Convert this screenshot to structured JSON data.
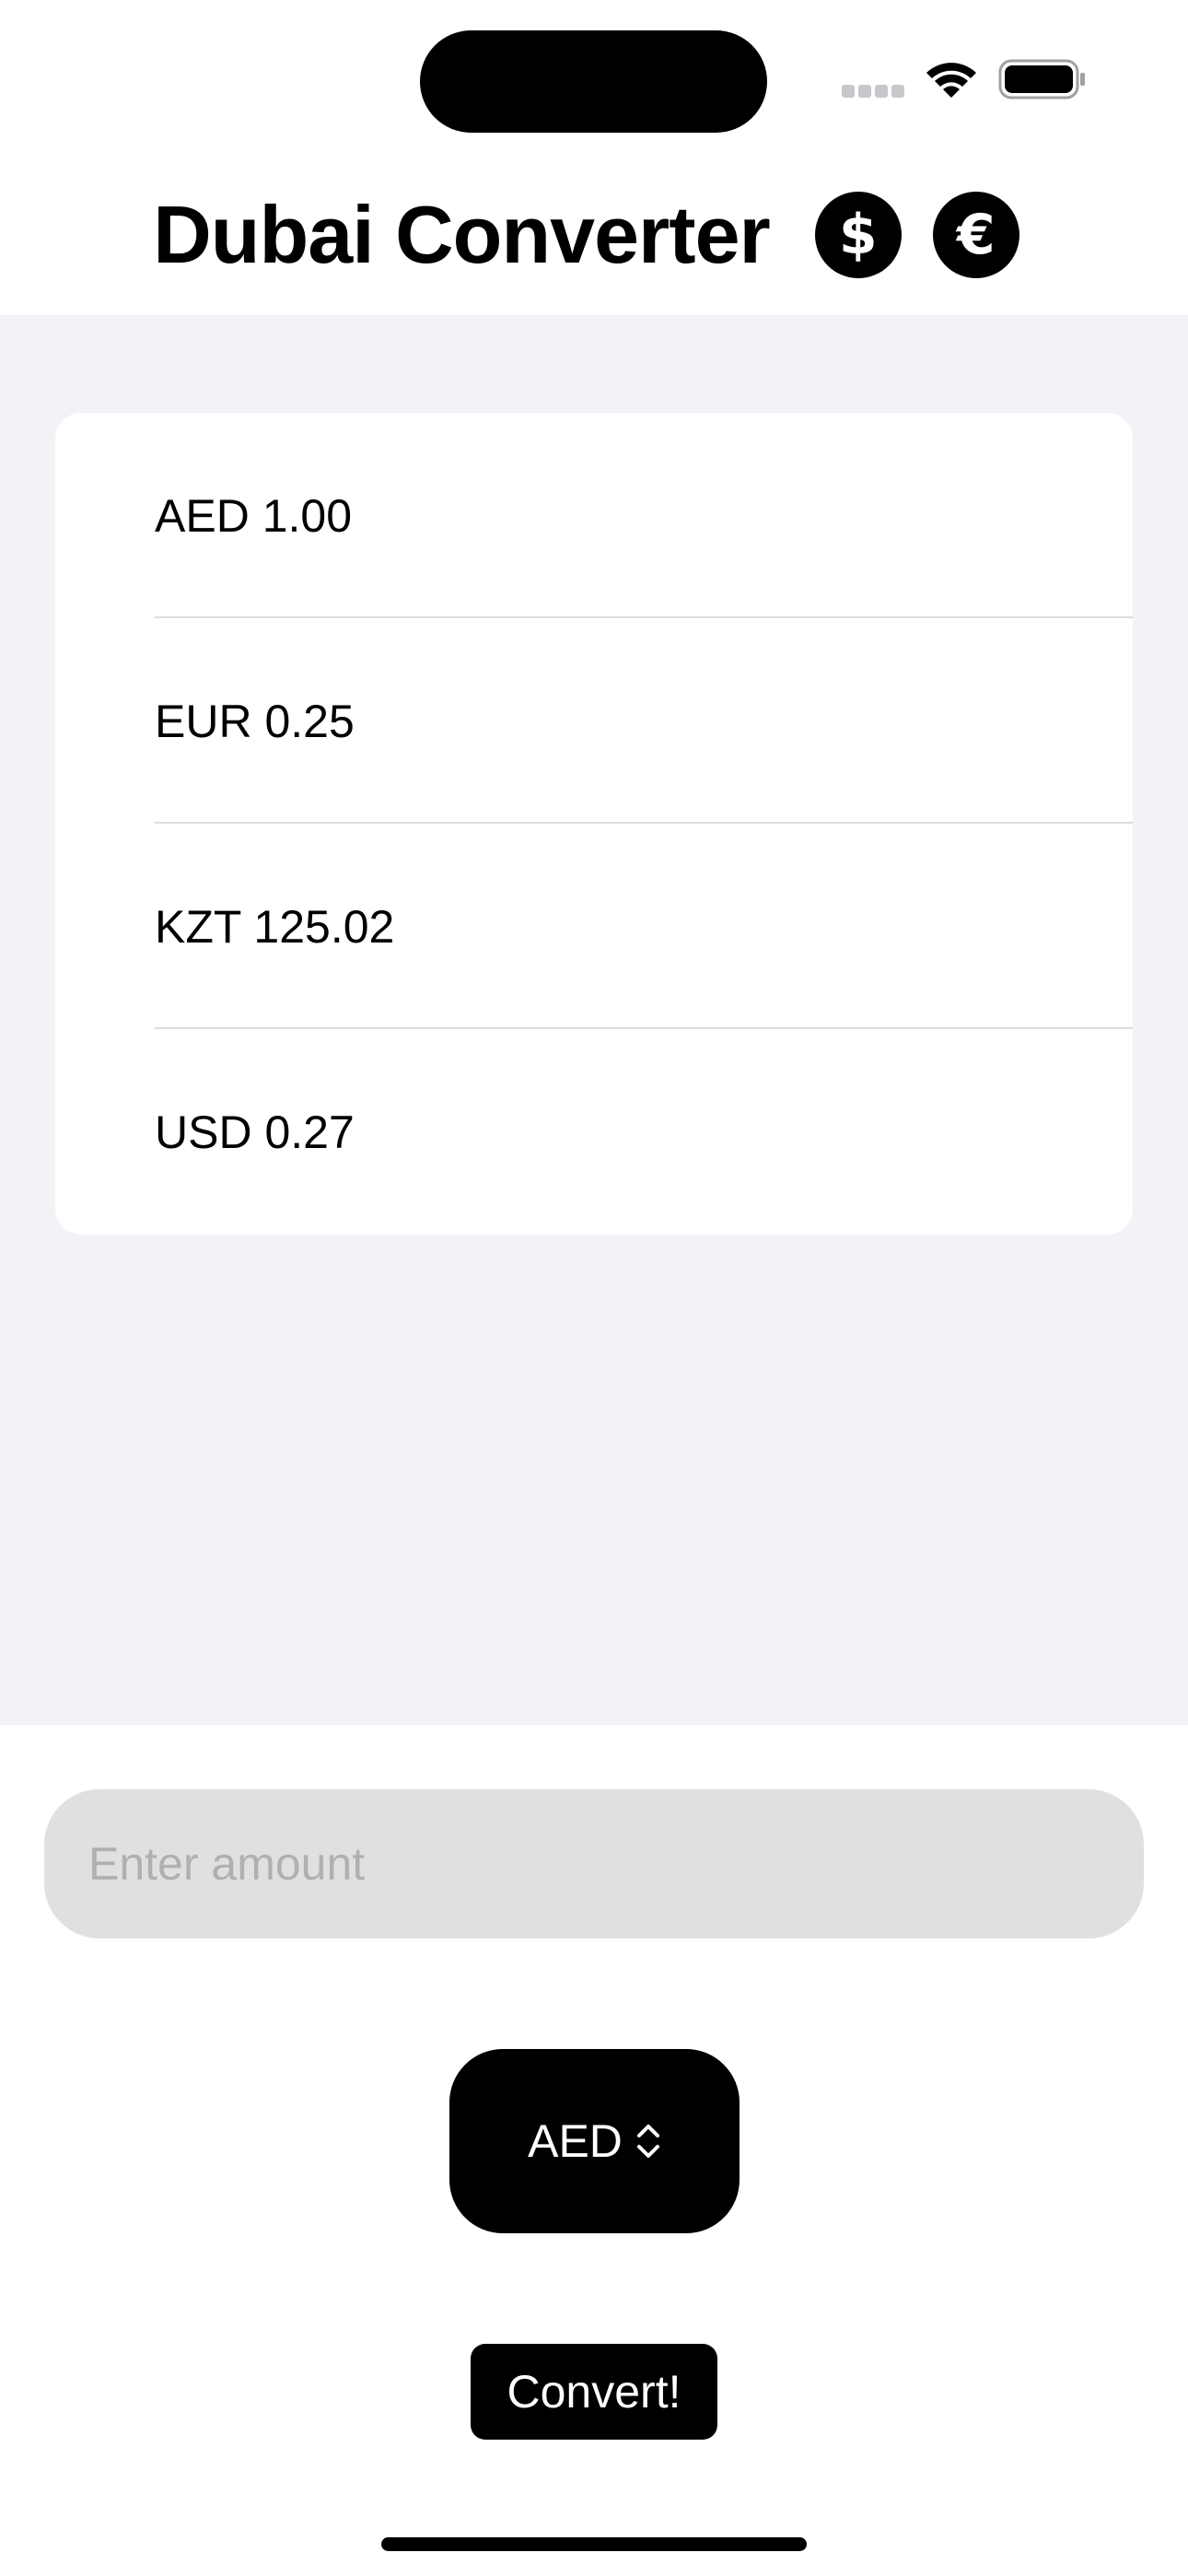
{
  "header": {
    "title": "Dubai Converter",
    "dollar_icon": "$",
    "euro_icon": "€"
  },
  "rates": [
    {
      "label": "AED 1.00"
    },
    {
      "label": "EUR 0.25"
    },
    {
      "label": "KZT 125.02"
    },
    {
      "label": "USD 0.27"
    }
  ],
  "amount": {
    "placeholder": "Enter amount",
    "value": ""
  },
  "currency_picker": {
    "selected": "AED"
  },
  "convert_button": {
    "label": "Convert!"
  },
  "colors": {
    "accent": "#000000",
    "list_background": "#f2f2f7",
    "input_background": "#e0e0e0"
  }
}
